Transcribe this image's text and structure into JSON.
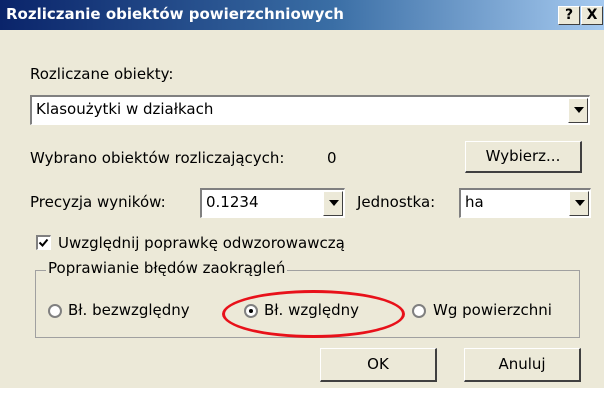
{
  "window": {
    "title": "Rozliczanie obiektów powierzchniowych",
    "help_label": "?",
    "close_label": "X"
  },
  "objects": {
    "label": "Rozliczane obiekty:",
    "selected": "Klasoużytki w działkach"
  },
  "selection": {
    "label": "Wybrano obiektów rozliczających:",
    "count": "0",
    "choose_button": "Wybierz..."
  },
  "precision": {
    "label": "Precyzja wyników:",
    "value": "0.1234"
  },
  "unit": {
    "label": "Jednostka:",
    "value": "ha"
  },
  "correction": {
    "label": "Uwzględnij poprawkę odwzorowawczą",
    "checked": true
  },
  "rounding": {
    "group_label": "Poprawianie błędów zaokrągleń",
    "options": [
      {
        "label": "Bł. bezwzględny",
        "selected": false
      },
      {
        "label": "Bł. względny",
        "selected": true
      },
      {
        "label": "Wg powierzchni",
        "selected": false
      }
    ]
  },
  "buttons": {
    "ok": "OK",
    "cancel": "Anuluj"
  },
  "colors": {
    "dialog_bg": "#ece9d8",
    "title_bar": "#0a246a",
    "highlight_ring": "#e8111a"
  }
}
